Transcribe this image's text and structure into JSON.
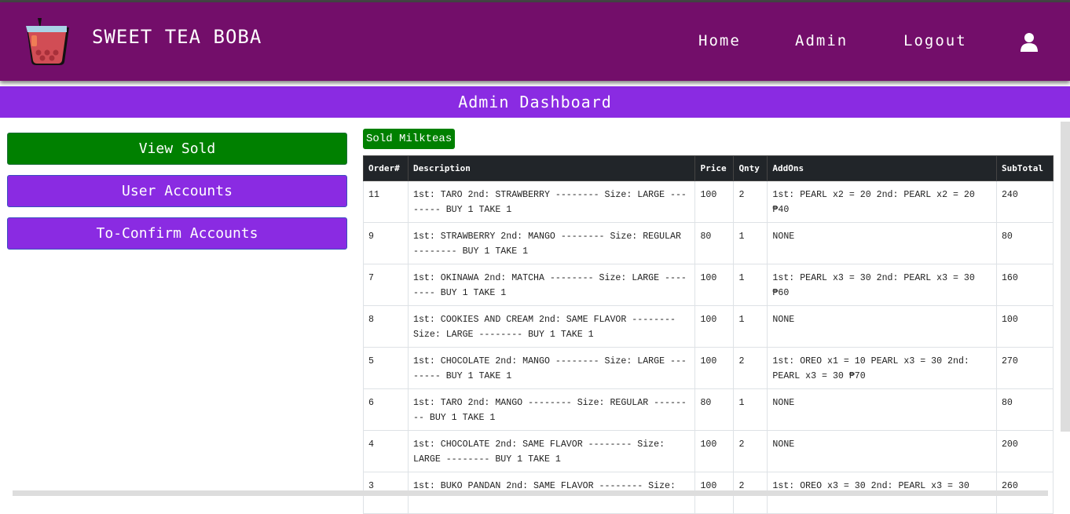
{
  "brand": {
    "title": "SWEET TEA BOBA"
  },
  "nav": {
    "home": "Home",
    "admin": "Admin",
    "logout": "Logout"
  },
  "dashboard_title": "Admin Dashboard",
  "sidebar": {
    "items": [
      {
        "label": "View Sold"
      },
      {
        "label": "User Accounts"
      },
      {
        "label": "To-Confirm Accounts"
      }
    ]
  },
  "section_badge": "Sold Milkteas",
  "table": {
    "headers": [
      "Order#",
      "Description",
      "Price",
      "Qnty",
      "AddOns",
      "SubTotal"
    ],
    "rows": [
      [
        "11",
        "1st: TARO 2nd: STRAWBERRY -------- Size: LARGE -------- BUY 1 TAKE 1",
        "100",
        "2",
        "1st: PEARL x2 = 20 2nd: PEARL x2 = 20 ₱40",
        "240"
      ],
      [
        "9",
        "1st: STRAWBERRY 2nd: MANGO -------- Size: REGULAR -------- BUY 1 TAKE 1",
        "80",
        "1",
        "NONE",
        "80"
      ],
      [
        "7",
        "1st: OKINAWA 2nd: MATCHA -------- Size: LARGE -------- BUY 1 TAKE 1",
        "100",
        "1",
        "1st: PEARL x3 = 30 2nd: PEARL x3 = 30 ₱60",
        "160"
      ],
      [
        "8",
        "1st: COOKIES AND CREAM 2nd: SAME FLAVOR -------- Size: LARGE -------- BUY 1 TAKE 1",
        "100",
        "1",
        "NONE",
        "100"
      ],
      [
        "5",
        "1st: CHOCOLATE 2nd: MANGO -------- Size: LARGE -------- BUY 1 TAKE 1",
        "100",
        "2",
        "1st: OREO x1 = 10 PEARL x3 = 30 2nd: PEARL x3 = 30 ₱70",
        "270"
      ],
      [
        "6",
        "1st: TARO 2nd: MANGO -------- Size: REGULAR -------- BUY 1 TAKE 1",
        "80",
        "1",
        "NONE",
        "80"
      ],
      [
        "4",
        "1st: CHOCOLATE 2nd: SAME FLAVOR -------- Size: LARGE -------- BUY 1 TAKE 1",
        "100",
        "2",
        "NONE",
        "200"
      ],
      [
        "3",
        "1st: BUKO PANDAN 2nd: SAME FLAVOR -------- Size:",
        "100",
        "2",
        "1st: OREO x3 = 30 2nd: PEARL x3 = 30",
        "260"
      ]
    ]
  }
}
